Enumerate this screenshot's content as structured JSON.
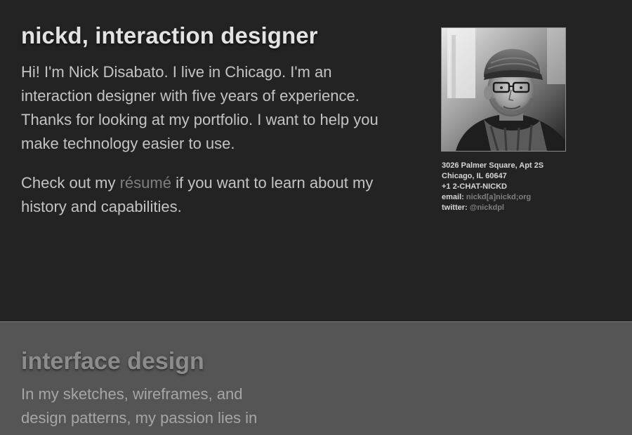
{
  "header": {
    "title": "nickd, interaction designer"
  },
  "intro": {
    "text": "Hi! I'm Nick Disabato. I live in Chicago. I'm an interaction designer with five years of experience. Thanks for looking at my portfolio. I want to help you make technology easier to use."
  },
  "cta": {
    "prefix": "Check out my ",
    "link_label": "résumé",
    "suffix": " if you want to learn about my history and capabilities."
  },
  "sidebar": {
    "photo_icon": "portrait-photo",
    "address_line1": "3026 Palmer Square, Apt 2S",
    "address_line2": "Chicago, IL 60647",
    "phone": "+1 2-CHAT-NICKD",
    "email_label": "email:",
    "email_value": "nickd[a]nickd;org",
    "twitter_label": "twitter:",
    "twitter_value": "@nickdpl"
  },
  "section": {
    "title": "interface design",
    "text": "In my sketches, wireframes, and design patterns, my passion lies in"
  },
  "colors": {
    "page_background": "#232323",
    "section_background": "#555555",
    "link": "#7f7f7f"
  }
}
